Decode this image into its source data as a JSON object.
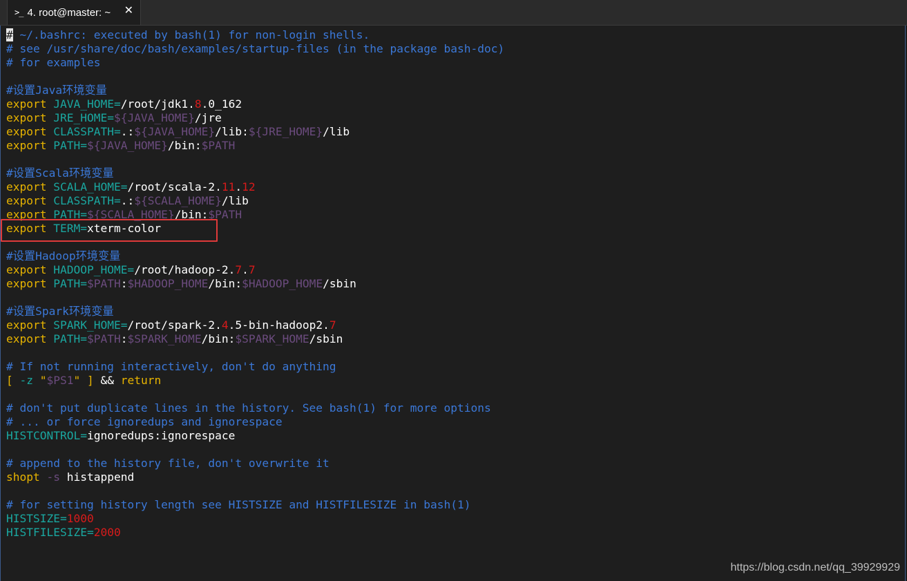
{
  "tab": {
    "icon": ">_",
    "title": "4. root@master: ~",
    "close": "✕"
  },
  "lines": [
    [
      {
        "t": "#",
        "c": "cursor"
      },
      {
        "t": " ~/.bashrc: executed by bash(1) for non-login shells.",
        "c": "comment"
      }
    ],
    [
      {
        "t": "# see /usr/share/doc/bash/examples/startup-files (in the package bash-doc)",
        "c": "comment"
      }
    ],
    [
      {
        "t": "# for examples",
        "c": "comment"
      }
    ],
    [],
    [
      {
        "t": "#设置Java环境变量",
        "c": "comment"
      }
    ],
    [
      {
        "t": "export ",
        "c": "kw"
      },
      {
        "t": "JAVA_HOME=",
        "c": "var"
      },
      {
        "t": "/root/jdk1.",
        "c": "plain"
      },
      {
        "t": "8",
        "c": "num"
      },
      {
        "t": ".0_162",
        "c": "plain"
      }
    ],
    [
      {
        "t": "export ",
        "c": "kw"
      },
      {
        "t": "JRE_HOME=",
        "c": "var"
      },
      {
        "t": "${JAVA_HOME}",
        "c": "ref"
      },
      {
        "t": "/jre",
        "c": "plain"
      }
    ],
    [
      {
        "t": "export ",
        "c": "kw"
      },
      {
        "t": "CLASSPATH=",
        "c": "var"
      },
      {
        "t": ".:",
        "c": "plain"
      },
      {
        "t": "${JAVA_HOME}",
        "c": "ref"
      },
      {
        "t": "/lib:",
        "c": "plain"
      },
      {
        "t": "${JRE_HOME}",
        "c": "ref"
      },
      {
        "t": "/lib",
        "c": "plain"
      }
    ],
    [
      {
        "t": "export ",
        "c": "kw"
      },
      {
        "t": "PATH=",
        "c": "var"
      },
      {
        "t": "${JAVA_HOME}",
        "c": "ref"
      },
      {
        "t": "/bin:",
        "c": "plain"
      },
      {
        "t": "$PATH",
        "c": "ref"
      }
    ],
    [],
    [
      {
        "t": "#设置Scala环境变量",
        "c": "comment"
      }
    ],
    [
      {
        "t": "export ",
        "c": "kw"
      },
      {
        "t": "SCALA_HOME=",
        "c": "var"
      },
      {
        "t": "/root/scala-2.",
        "c": "plain"
      },
      {
        "t": "11",
        "c": "num"
      },
      {
        "t": ".",
        "c": "plain"
      },
      {
        "t": "12",
        "c": "num"
      }
    ],
    [
      {
        "t": "export ",
        "c": "kw"
      },
      {
        "t": "CLASSPATH=",
        "c": "var"
      },
      {
        "t": ".:",
        "c": "plain"
      },
      {
        "t": "${SCALA_HOME}",
        "c": "ref"
      },
      {
        "t": "/lib",
        "c": "plain"
      }
    ],
    [
      {
        "t": "export ",
        "c": "kw"
      },
      {
        "t": "PATH=",
        "c": "var"
      },
      {
        "t": "${SCALA_HOME}",
        "c": "ref"
      },
      {
        "t": "/bin:",
        "c": "plain"
      },
      {
        "t": "$PATH",
        "c": "ref"
      }
    ],
    [
      {
        "t": "export ",
        "c": "kw"
      },
      {
        "t": "TERM=",
        "c": "var"
      },
      {
        "t": "xterm-color",
        "c": "plain"
      }
    ],
    [],
    [
      {
        "t": "#设置Hadoop环境变量",
        "c": "comment"
      }
    ],
    [
      {
        "t": "export ",
        "c": "kw"
      },
      {
        "t": "HADOOP_HOME=",
        "c": "var"
      },
      {
        "t": "/root/hadoop-2.",
        "c": "plain"
      },
      {
        "t": "7",
        "c": "num"
      },
      {
        "t": ".",
        "c": "plain"
      },
      {
        "t": "7",
        "c": "num"
      }
    ],
    [
      {
        "t": "export ",
        "c": "kw"
      },
      {
        "t": "PATH=",
        "c": "var"
      },
      {
        "t": "$PATH",
        "c": "ref"
      },
      {
        "t": ":",
        "c": "plain"
      },
      {
        "t": "$HADOOP_HOME",
        "c": "ref"
      },
      {
        "t": "/bin:",
        "c": "plain"
      },
      {
        "t": "$HADOOP_HOME",
        "c": "ref"
      },
      {
        "t": "/sbin",
        "c": "plain"
      }
    ],
    [],
    [
      {
        "t": "#设置Spark环境变量",
        "c": "comment"
      }
    ],
    [
      {
        "t": "export ",
        "c": "kw"
      },
      {
        "t": "SPARK_HOME=",
        "c": "var"
      },
      {
        "t": "/root/spark-2.",
        "c": "plain"
      },
      {
        "t": "4",
        "c": "num"
      },
      {
        "t": ".5-bin-hadoop2.",
        "c": "plain"
      },
      {
        "t": "7",
        "c": "num"
      }
    ],
    [
      {
        "t": "export ",
        "c": "kw"
      },
      {
        "t": "PATH=",
        "c": "var"
      },
      {
        "t": "$PATH",
        "c": "ref"
      },
      {
        "t": ":",
        "c": "plain"
      },
      {
        "t": "$SPARK_HOME",
        "c": "ref"
      },
      {
        "t": "/bin:",
        "c": "plain"
      },
      {
        "t": "$SPARK_HOME",
        "c": "ref"
      },
      {
        "t": "/sbin",
        "c": "plain"
      }
    ],
    [],
    [
      {
        "t": "# If not running interactively, don't do anything",
        "c": "comment"
      }
    ],
    [
      {
        "t": "[ ",
        "c": "kw"
      },
      {
        "t": "-z ",
        "c": "var"
      },
      {
        "t": "\"",
        "c": "kw"
      },
      {
        "t": "$PS1",
        "c": "ref"
      },
      {
        "t": "\"",
        "c": "kw"
      },
      {
        "t": " ] ",
        "c": "kw"
      },
      {
        "t": "&& ",
        "c": "plain"
      },
      {
        "t": "return",
        "c": "kw"
      }
    ],
    [],
    [
      {
        "t": "# don't put duplicate lines in the history. See bash(1) for more options",
        "c": "comment"
      }
    ],
    [
      {
        "t": "# ... or force ignoredups and ignorespace",
        "c": "comment"
      }
    ],
    [
      {
        "t": "HISTCONTROL=",
        "c": "var"
      },
      {
        "t": "ignoredups:ignorespace",
        "c": "plain"
      }
    ],
    [],
    [
      {
        "t": "# append to the history file, don't overwrite it",
        "c": "comment"
      }
    ],
    [
      {
        "t": "shopt ",
        "c": "kw"
      },
      {
        "t": "-s ",
        "c": "ref"
      },
      {
        "t": "histappend",
        "c": "plain"
      }
    ],
    [],
    [
      {
        "t": "# for setting history length see HISTSIZE and HISTFILESIZE in bash(1)",
        "c": "comment"
      }
    ],
    [
      {
        "t": "HISTSIZE=",
        "c": "var"
      },
      {
        "t": "1000",
        "c": "num"
      }
    ],
    [
      {
        "t": "HISTFILESIZE=",
        "c": "var"
      },
      {
        "t": "2000",
        "c": "num"
      }
    ]
  ],
  "watermark": "https://blog.csdn.net/qq_39929929"
}
